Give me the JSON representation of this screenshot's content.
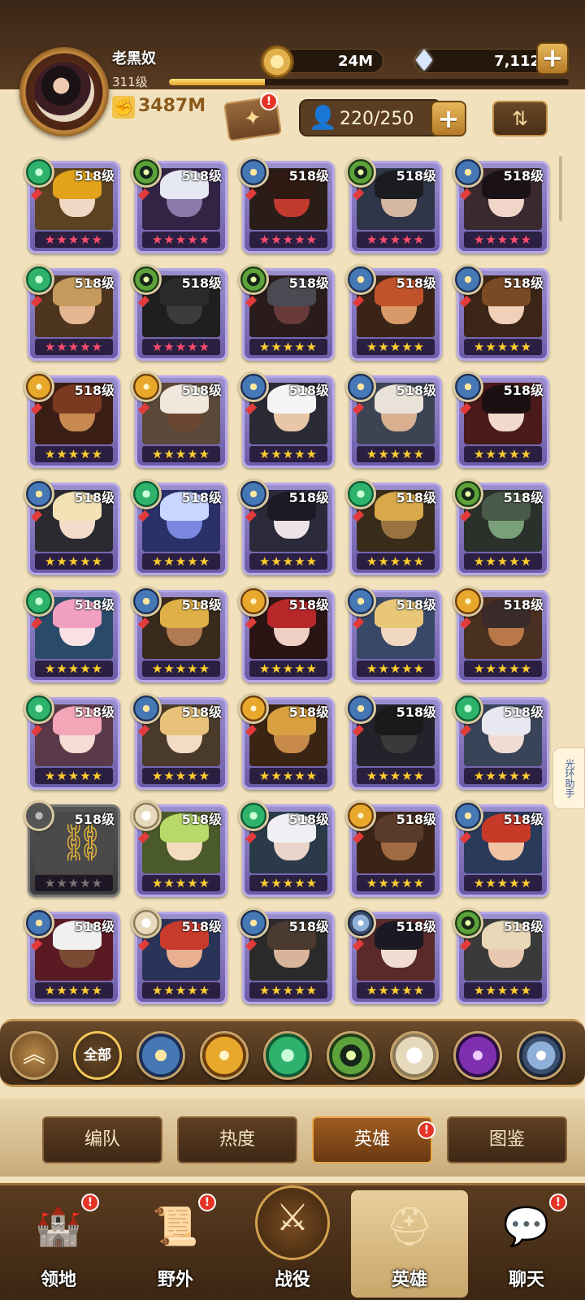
{
  "header": {
    "player_name": "老黑奴",
    "player_level": "311级",
    "xp_progress": 0.24,
    "gold": "24M",
    "gems": "7,112",
    "power": "3487M",
    "hero_capacity": "220/250"
  },
  "heroes": [
    {
      "level": "518级",
      "faction": "nature",
      "stars": "red",
      "hair": "#e2a21a",
      "skin": "#f1d8c4",
      "bg": "#5b4220"
    },
    {
      "level": "518级",
      "faction": "eye",
      "stars": "red",
      "hair": "#e5e8f0",
      "skin": "#8b7aa8",
      "bg": "#332446"
    },
    {
      "level": "518级",
      "faction": "star",
      "stars": "red",
      "hair": "#2e1a12",
      "skin": "#c23b2e",
      "bg": "#2a1d18"
    },
    {
      "level": "518级",
      "faction": "eye",
      "stars": "red",
      "hair": "#1b1b22",
      "skin": "#d6b8a0",
      "bg": "#2f3648"
    },
    {
      "level": "518级",
      "faction": "star",
      "stars": "red",
      "hair": "#1a1216",
      "skin": "#f1d5c8",
      "bg": "#3a2a30"
    },
    {
      "level": "518级",
      "faction": "nature",
      "stars": "red",
      "hair": "#c59a5c",
      "skin": "#e5b892",
      "bg": "#4e3520"
    },
    {
      "level": "518级",
      "faction": "eye",
      "stars": "red",
      "hair": "#2b2b2b",
      "skin": "#3c3c3c",
      "bg": "#1f1f1f"
    },
    {
      "level": "518级",
      "faction": "eye",
      "stars": "gold",
      "hair": "#4a4a52",
      "skin": "#6a3a3a",
      "bg": "#2a1c1c"
    },
    {
      "level": "518级",
      "faction": "star",
      "stars": "gold",
      "hair": "#c0532a",
      "skin": "#d89a68",
      "bg": "#3a2418"
    },
    {
      "level": "518级",
      "faction": "star",
      "stars": "gold",
      "hair": "#7a4a24",
      "skin": "#f0d0b8",
      "bg": "#3c2416"
    },
    {
      "level": "518级",
      "faction": "sun",
      "stars": "gold",
      "hair": "#7a3a22",
      "skin": "#c98a52",
      "bg": "#3a1e14"
    },
    {
      "level": "518级",
      "faction": "sun",
      "stars": "gold",
      "hair": "#f0e8dc",
      "skin": "#6b4630",
      "bg": "#5a4838"
    },
    {
      "level": "518级",
      "faction": "star",
      "stars": "gold",
      "hair": "#f5f5f5",
      "skin": "#e7c7a8",
      "bg": "#2a2a34"
    },
    {
      "level": "518级",
      "faction": "star",
      "stars": "gold",
      "hair": "#e8e2d8",
      "skin": "#d8b090",
      "bg": "#3c4454"
    },
    {
      "level": "518级",
      "faction": "star",
      "stars": "gold",
      "hair": "#1a1012",
      "skin": "#f1d9cc",
      "bg": "#4a1a1a"
    },
    {
      "level": "518级",
      "faction": "star",
      "stars": "gold",
      "hair": "#f2e2b6",
      "skin": "#f4dccb",
      "bg": "#2a2a30"
    },
    {
      "level": "518级",
      "faction": "nature",
      "stars": "gold",
      "hair": "#c9d6ff",
      "skin": "#7a88e0",
      "bg": "#2a3068"
    },
    {
      "level": "518级",
      "faction": "star",
      "stars": "gold",
      "hair": "#1c1a24",
      "skin": "#efe2e8",
      "bg": "#2a2a3a"
    },
    {
      "level": "518级",
      "faction": "nature",
      "stars": "gold",
      "hair": "#d8a84a",
      "skin": "#9a7440",
      "bg": "#3a2c1a"
    },
    {
      "level": "518级",
      "faction": "eye",
      "stars": "gold",
      "hair": "#4a5a48",
      "skin": "#7aa07a",
      "bg": "#2a302a"
    },
    {
      "level": "518级",
      "faction": "nature",
      "stars": "gold",
      "hair": "#f2a0c2",
      "skin": "#f8e0e4",
      "bg": "#2a4a6a"
    },
    {
      "level": "518级",
      "faction": "star",
      "stars": "gold",
      "hair": "#e0b048",
      "skin": "#b07a52",
      "bg": "#3a2a1c"
    },
    {
      "level": "518级",
      "faction": "sun",
      "stars": "gold",
      "hair": "#b8282a",
      "skin": "#f0d0c4",
      "bg": "#2a1414"
    },
    {
      "level": "518级",
      "faction": "star",
      "stars": "gold",
      "hair": "#e8c878",
      "skin": "#f0d8c0",
      "bg": "#3a4868"
    },
    {
      "level": "518级",
      "faction": "sun",
      "stars": "gold",
      "hair": "#3a2a2a",
      "skin": "#b87848",
      "bg": "#4a3020"
    },
    {
      "level": "518级",
      "faction": "nature",
      "stars": "gold",
      "hair": "#f2a6b8",
      "skin": "#f6dcd4",
      "bg": "#5a3a48"
    },
    {
      "level": "518级",
      "faction": "star",
      "stars": "gold",
      "hair": "#e8c27a",
      "skin": "#f4dcc4",
      "bg": "#4a3a2a"
    },
    {
      "level": "518级",
      "faction": "sun",
      "stars": "gold",
      "hair": "#d8a040",
      "skin": "#c88a4a",
      "bg": "#3a2414"
    },
    {
      "level": "518级",
      "faction": "star",
      "stars": "gold",
      "hair": "#1a1a1a",
      "skin": "#3a3a3a",
      "bg": "#24222a"
    },
    {
      "level": "518级",
      "faction": "nature",
      "stars": "gold",
      "hair": "#e8e8f0",
      "skin": "#f0dcd4",
      "bg": "#3a4458"
    },
    {
      "level": "518级",
      "locked": true,
      "faction": "lock",
      "stars": "grey",
      "hair": "#4a4a4a",
      "skin": "#4a4a4a",
      "bg": "#4a4a4a"
    },
    {
      "level": "518级",
      "faction": "light",
      "stars": "gold",
      "hair": "#b8d86a",
      "skin": "#f4dcc0",
      "bg": "#4a5a2a"
    },
    {
      "level": "518级",
      "faction": "nature",
      "stars": "gold",
      "hair": "#f0f0f4",
      "skin": "#e8d4c8",
      "bg": "#2a3a48"
    },
    {
      "level": "518级",
      "faction": "sun",
      "stars": "gold",
      "hair": "#5a3a28",
      "skin": "#a06a42",
      "bg": "#3a2418"
    },
    {
      "level": "518级",
      "faction": "star",
      "stars": "gold",
      "hair": "#c83a28",
      "skin": "#f0c4a4",
      "bg": "#2a3a5a"
    },
    {
      "level": "518级",
      "faction": "star",
      "stars": "gold",
      "hair": "#f0f0f0",
      "skin": "#7a4a32",
      "bg": "#5a1a24"
    },
    {
      "level": "518级",
      "faction": "light",
      "stars": "gold",
      "hair": "#c83a2a",
      "skin": "#e8b090",
      "bg": "#2a3458"
    },
    {
      "level": "518级",
      "faction": "star",
      "stars": "gold",
      "hair": "#4a3a30",
      "skin": "#d8b49a",
      "bg": "#2a2a2a"
    },
    {
      "level": "518级",
      "faction": "tech",
      "stars": "gold",
      "hair": "#1a1a24",
      "skin": "#f0dcd0",
      "bg": "#5a2a2a"
    },
    {
      "level": "518级",
      "faction": "eye",
      "stars": "gold",
      "hair": "#e8d8b8",
      "skin": "#e8c8b0",
      "bg": "#3a3a3a"
    }
  ],
  "star_glyphs": "★★★★★",
  "filters": {
    "collapse_glyph": "︽",
    "all_label": "全部",
    "factions": [
      "star",
      "sun",
      "nature",
      "eye",
      "light",
      "dark",
      "tech"
    ]
  },
  "subtabs": [
    {
      "label": "编队",
      "active": false,
      "badge": false
    },
    {
      "label": "热度",
      "active": false,
      "badge": false
    },
    {
      "label": "英雄",
      "active": true,
      "badge": true
    },
    {
      "label": "图鉴",
      "active": false,
      "badge": false
    }
  ],
  "nav": [
    {
      "label": "领地",
      "icon": "castle-icon",
      "glyph": "🏰",
      "active": false,
      "badge": true
    },
    {
      "label": "野外",
      "icon": "map-scroll-icon",
      "glyph": "📜",
      "active": false,
      "badge": true
    },
    {
      "label": "战役",
      "icon": "sword-shield-icon",
      "glyph": "⚔",
      "active": false,
      "badge": false
    },
    {
      "label": "英雄",
      "icon": "helmet-icon",
      "glyph": "⛑",
      "active": true,
      "badge": false
    },
    {
      "label": "聊天",
      "icon": "chat-bubble-icon",
      "glyph": "💬",
      "active": false,
      "badge": true
    }
  ],
  "side_tab": "光环助手",
  "badge_glyph": "!",
  "colors": {
    "accent": "#e9a94a",
    "badge": "#e53425",
    "bg": "#f1e1bd"
  }
}
